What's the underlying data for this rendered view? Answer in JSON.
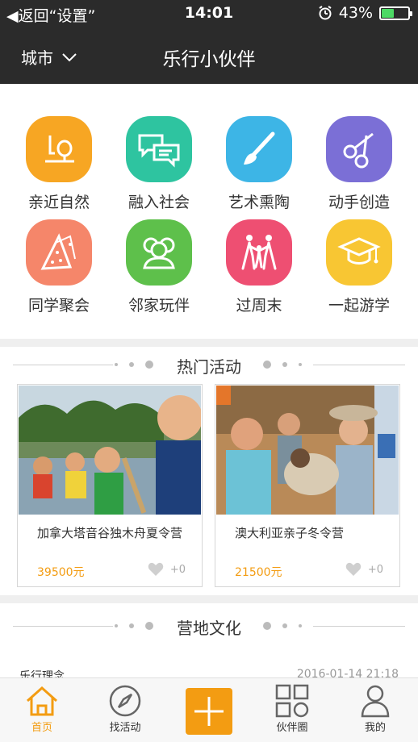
{
  "status_bar": {
    "back_label": "返回“设置”",
    "time": "14:01",
    "battery_percent": "43%",
    "battery_level": 0.43
  },
  "nav": {
    "city_label": "城市",
    "title": "乐行小伙伴"
  },
  "categories": [
    {
      "label": "亲近自然",
      "icon": "nature-icon",
      "color": "#f7a623"
    },
    {
      "label": "融入社会",
      "icon": "chat-bubbles-icon",
      "color": "#2ec4a0"
    },
    {
      "label": "艺术熏陶",
      "icon": "paintbrush-icon",
      "color": "#3db5e6"
    },
    {
      "label": "动手创造",
      "icon": "scissors-icon",
      "color": "#7b6fd6"
    },
    {
      "label": "同学聚会",
      "icon": "party-hat-icon",
      "color": "#f5866a"
    },
    {
      "label": "邻家玩伴",
      "icon": "friends-icon",
      "color": "#5ec04b"
    },
    {
      "label": "过周末",
      "icon": "family-icon",
      "color": "#ee4f72"
    },
    {
      "label": "一起游学",
      "icon": "graduation-cap-icon",
      "color": "#f8c633"
    }
  ],
  "hot": {
    "title": "热门活动",
    "items": [
      {
        "name": "加拿大塔音谷独木舟夏令营",
        "price": "39500元",
        "likes": "+0"
      },
      {
        "name": "澳大利亚亲子冬令营",
        "price": "21500元",
        "likes": "+0"
      }
    ]
  },
  "camp": {
    "title": "营地文化",
    "row_label": "乐行理念",
    "row_date": "2016-01-14 21:18"
  },
  "tabbar": {
    "items": [
      {
        "label": "首页",
        "icon": "home-icon",
        "active": true
      },
      {
        "label": "找活动",
        "icon": "compass-icon",
        "active": false
      },
      {
        "label": "",
        "icon": "plus-icon",
        "active": false
      },
      {
        "label": "伙伴圈",
        "icon": "grid-icon",
        "active": false
      },
      {
        "label": "我的",
        "icon": "person-icon",
        "active": false
      }
    ]
  },
  "colors": {
    "accent": "#f39c12",
    "topbar": "#2b2b2b"
  }
}
